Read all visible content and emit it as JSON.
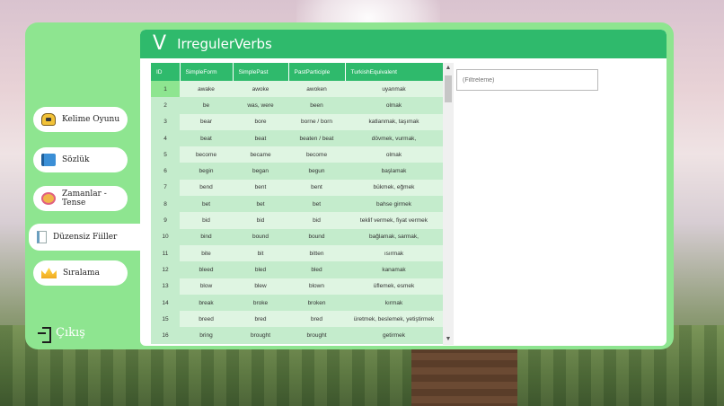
{
  "app": {
    "logo_letter": "V",
    "title": "IrregulerVerbs"
  },
  "sidebar": {
    "items": [
      {
        "label": "Kelime Oyunu",
        "icon": "game-box-icon"
      },
      {
        "label": "Sözlük",
        "icon": "book-icon"
      },
      {
        "label": "Zamanlar - Tense",
        "icon": "alarm-clock-icon"
      },
      {
        "label": "Düzensiz Fiiller",
        "icon": "document-icon",
        "active": true
      },
      {
        "label": "Sıralama",
        "icon": "crown-icon"
      }
    ],
    "exit_label": "Çıkış"
  },
  "table": {
    "columns": [
      "ID",
      "SimpleForm",
      "SimplePast",
      "PastParticiple",
      "TurkishEquivalent"
    ],
    "rows": [
      [
        "1",
        "awake",
        "awoke",
        "awoken",
        "uyanmak"
      ],
      [
        "2",
        "be",
        "was, were",
        "been",
        "olmak"
      ],
      [
        "3",
        "bear",
        "bore",
        "borne / born",
        "katlanmak, taşımak"
      ],
      [
        "4",
        "beat",
        "beat",
        "beaten / beat",
        "dövmek, vurmak,"
      ],
      [
        "5",
        "become",
        "became",
        "become",
        "olmak"
      ],
      [
        "6",
        "begin",
        "began",
        "begun",
        "başlamak"
      ],
      [
        "7",
        "bend",
        "bent",
        "bent",
        "bükmek, eğmek"
      ],
      [
        "8",
        "bet",
        "bet",
        "bet",
        "bahse girmek"
      ],
      [
        "9",
        "bid",
        "bid",
        "bid",
        "teklif vermek, fiyat vermek"
      ],
      [
        "10",
        "bind",
        "bound",
        "bound",
        "bağlamak, sarmak,"
      ],
      [
        "11",
        "bite",
        "bit",
        "bitten",
        "ısırmak"
      ],
      [
        "12",
        "bleed",
        "bled",
        "bled",
        "kanamak"
      ],
      [
        "13",
        "blow",
        "blew",
        "blown",
        "üflemek, esmek"
      ],
      [
        "14",
        "break",
        "broke",
        "broken",
        "kırmak"
      ],
      [
        "15",
        "breed",
        "bred",
        "bred",
        "üretmek, beslemek, yetiştirmek"
      ],
      [
        "16",
        "bring",
        "brought",
        "brought",
        "getirmek"
      ]
    ],
    "selected_row": "1"
  },
  "filter": {
    "placeholder": "(Filtreleme)"
  },
  "colors": {
    "panel_green": "#8ee590",
    "header_green": "#2fba6c",
    "row_light": "#dff5e2",
    "row_dark": "#c4eccc"
  }
}
